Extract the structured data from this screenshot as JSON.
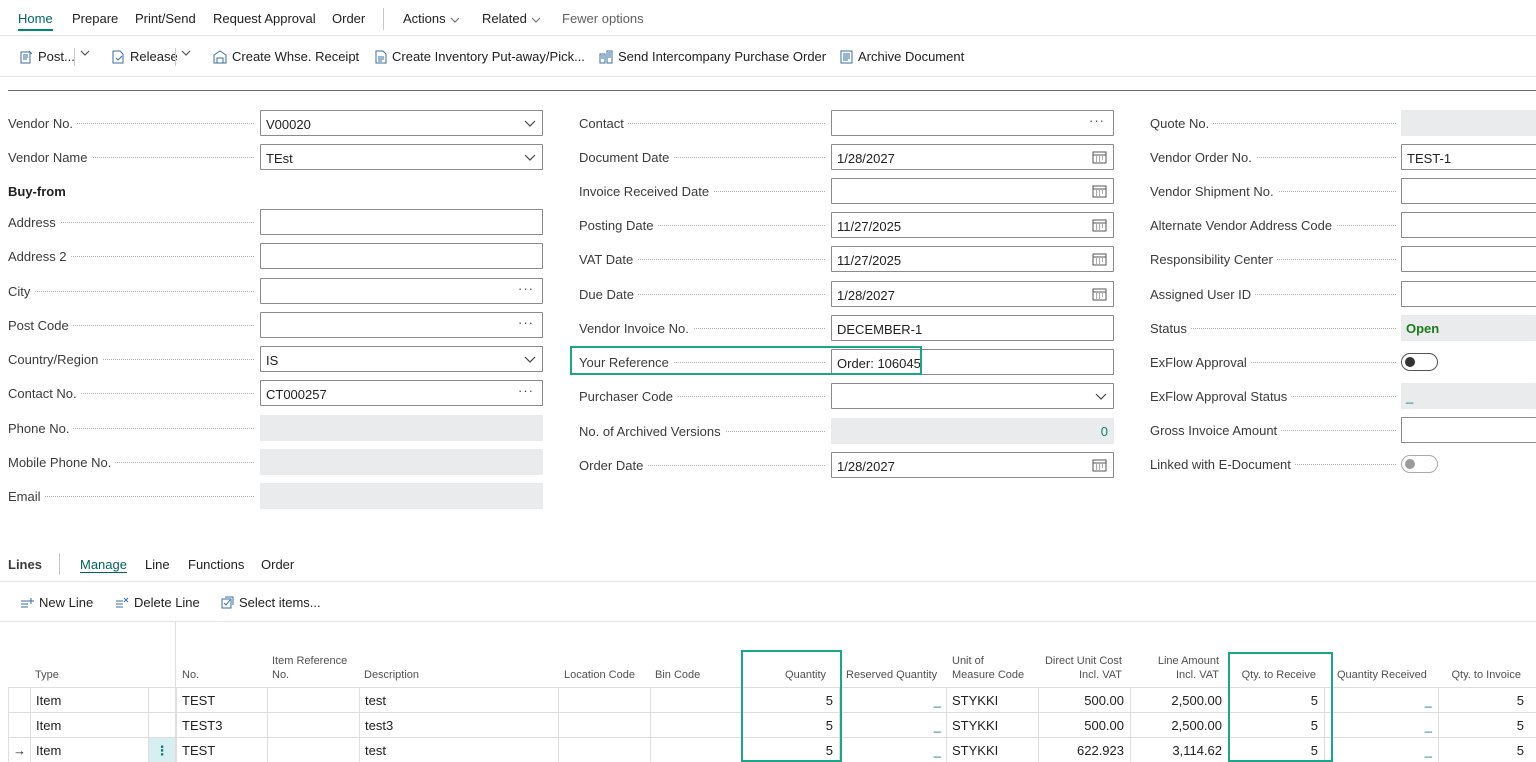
{
  "topnav": {
    "tabs": [
      "Home",
      "Prepare",
      "Print/Send",
      "Request Approval",
      "Order"
    ],
    "actions": "Actions",
    "related": "Related",
    "fewer": "Fewer options"
  },
  "toolbar": {
    "post": "Post...",
    "release": "Release",
    "whse_receipt": "Create Whse. Receipt",
    "inv_putaway": "Create Inventory Put-away/Pick...",
    "intercompany": "Send Intercompany Purchase Order",
    "archive": "Archive Document"
  },
  "col1": {
    "vendor_no": {
      "label": "Vendor No.",
      "value": "V00020"
    },
    "vendor_name": {
      "label": "Vendor Name",
      "value": "TEst"
    },
    "buy_from": "Buy-from",
    "address": {
      "label": "Address",
      "value": ""
    },
    "address2": {
      "label": "Address 2",
      "value": ""
    },
    "city": {
      "label": "City",
      "value": ""
    },
    "post_code": {
      "label": "Post Code",
      "value": ""
    },
    "country": {
      "label": "Country/Region",
      "value": "IS"
    },
    "contact_no": {
      "label": "Contact No.",
      "value": "CT000257"
    },
    "phone": {
      "label": "Phone No.",
      "value": ""
    },
    "mobile": {
      "label": "Mobile Phone No.",
      "value": ""
    },
    "email": {
      "label": "Email",
      "value": ""
    }
  },
  "col2": {
    "contact": {
      "label": "Contact",
      "value": ""
    },
    "document_date": {
      "label": "Document Date",
      "value": "1/28/2027"
    },
    "invoice_received": {
      "label": "Invoice Received Date",
      "value": ""
    },
    "posting_date": {
      "label": "Posting Date",
      "value": "11/27/2025"
    },
    "vat_date": {
      "label": "VAT Date",
      "value": "11/27/2025"
    },
    "due_date": {
      "label": "Due Date",
      "value": "1/28/2027"
    },
    "vendor_invoice": {
      "label": "Vendor Invoice No.",
      "value": "DECEMBER-1"
    },
    "your_reference": {
      "label": "Your Reference",
      "value": "Order: 106045"
    },
    "purchaser": {
      "label": "Purchaser Code",
      "value": ""
    },
    "archived": {
      "label": "No. of Archived Versions",
      "value": "0"
    },
    "order_date": {
      "label": "Order Date",
      "value": "1/28/2027"
    }
  },
  "col3": {
    "quote_no": {
      "label": "Quote No.",
      "value": ""
    },
    "vendor_order": {
      "label": "Vendor Order No.",
      "value": "TEST-1"
    },
    "vendor_shipment": {
      "label": "Vendor Shipment No.",
      "value": ""
    },
    "alt_address": {
      "label": "Alternate Vendor Address Code",
      "value": ""
    },
    "resp_center": {
      "label": "Responsibility Center",
      "value": ""
    },
    "assigned_user": {
      "label": "Assigned User ID",
      "value": ""
    },
    "status": {
      "label": "Status",
      "value": "Open"
    },
    "exflow_approval": {
      "label": "ExFlow Approval"
    },
    "exflow_status": {
      "label": "ExFlow Approval Status",
      "value": "_"
    },
    "gross_amount": {
      "label": "Gross Invoice Amount",
      "value": ""
    },
    "linked_edoc": {
      "label": "Linked with E-Document"
    }
  },
  "lines": {
    "title": "Lines",
    "tabs": [
      "Manage",
      "Line",
      "Functions",
      "Order"
    ],
    "new_line": "New Line",
    "delete_line": "Delete Line",
    "select_items": "Select items...",
    "headers": {
      "type": "Type",
      "no": "No.",
      "item_ref_1": "Item Reference",
      "item_ref_2": "No.",
      "description": "Description",
      "location": "Location Code",
      "bin": "Bin Code",
      "quantity": "Quantity",
      "reserved": "Reserved Quantity",
      "uom_1": "Unit of",
      "uom_2": "Measure Code",
      "duc_1": "Direct Unit Cost",
      "duc_2": "Incl. VAT",
      "la_1": "Line Amount",
      "la_2": "Incl. VAT",
      "qty_receive": "Qty. to Receive",
      "qty_received": "Quantity Received",
      "qty_invoice": "Qty. to Invoice"
    },
    "rows": [
      {
        "marker": "",
        "type": "Item",
        "no": "TEST",
        "description": "test",
        "quantity": "5",
        "reserved": "_",
        "uom": "STYKKI",
        "unit_cost": "500.00",
        "line_amount": "2,500.00",
        "qty_receive": "5",
        "qty_received": "_",
        "qty_invoice": "5"
      },
      {
        "marker": "",
        "type": "Item",
        "no": "TEST3",
        "description": "test3",
        "quantity": "5",
        "reserved": "_",
        "uom": "STYKKI",
        "unit_cost": "500.00",
        "line_amount": "2,500.00",
        "qty_receive": "5",
        "qty_received": "_",
        "qty_invoice": "5"
      },
      {
        "marker": "→",
        "type": "Item",
        "no": "TEST",
        "description": "test",
        "quantity": "5",
        "reserved": "_",
        "uom": "STYKKI",
        "unit_cost": "622.923",
        "line_amount": "3,114.62",
        "qty_receive": "5",
        "qty_received": "_",
        "qty_invoice": "5"
      }
    ]
  },
  "colors": {
    "accent": "#00857a",
    "highlight": "#1ba589",
    "status_open": "#1c7a1c"
  }
}
